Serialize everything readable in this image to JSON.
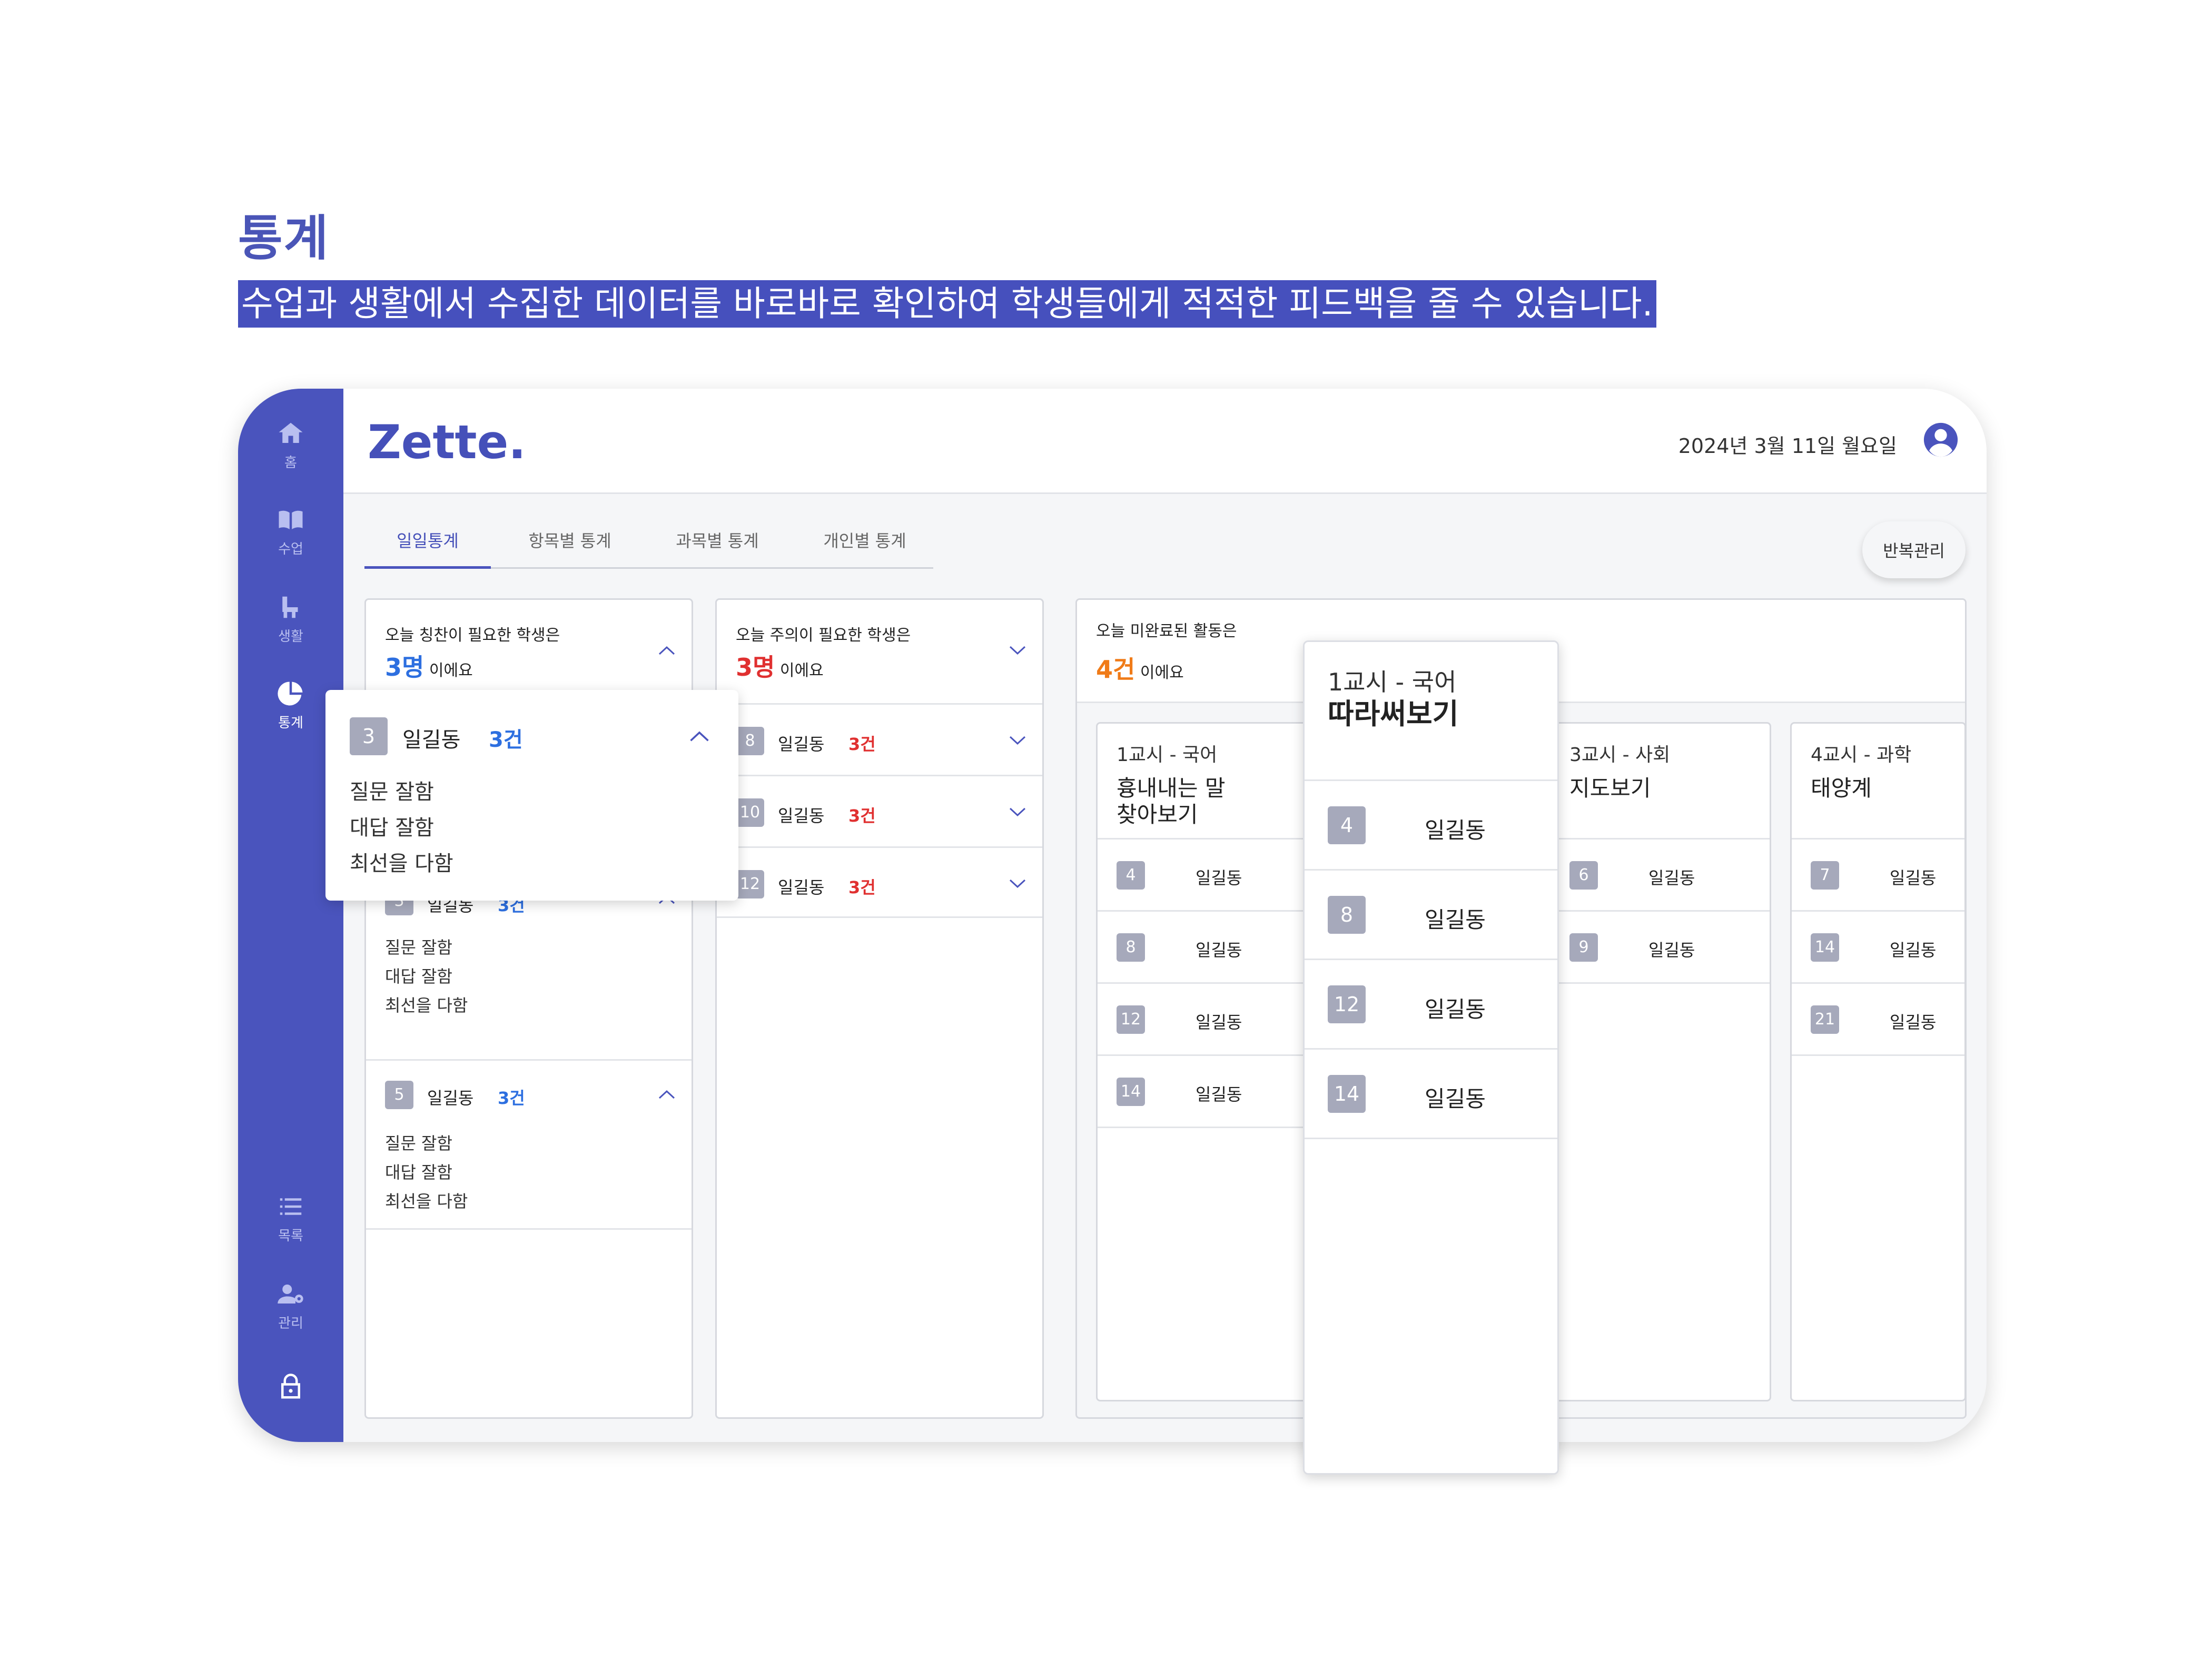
{
  "header": {
    "title": "통계",
    "subtitle": "수업과 생활에서 수집한 데이터를 바로바로 확인하여 학생들에게 적적한 피드백을 줄 수 있습니다."
  },
  "app": {
    "logo": "Zette.",
    "date": "2024년 3월 11일 월요일",
    "accent": "#4a54bd"
  },
  "sidebar": {
    "items": [
      {
        "label": "홈",
        "icon": "home-icon"
      },
      {
        "label": "수업",
        "icon": "book-icon"
      },
      {
        "label": "생활",
        "icon": "chair-icon"
      },
      {
        "label": "통계",
        "icon": "pie-chart-icon"
      },
      {
        "label": "목록",
        "icon": "list-icon"
      },
      {
        "label": "관리",
        "icon": "user-gear-icon"
      }
    ],
    "lock_icon": "lock-icon"
  },
  "tabs": [
    "일일통계",
    "항목별 통계",
    "과목별 통계",
    "개인별 통계"
  ],
  "repeat_button": "반복관리",
  "praise": {
    "title": "오늘 칭찬이 필요한 학생은",
    "count": "3명",
    "suffix": "이에요",
    "rows": [
      {
        "num": "3",
        "name": "일길동",
        "count": "3건",
        "details": [
          "질문 잘함",
          "대답 잘함",
          "최선을 다함"
        ]
      },
      {
        "num": "5",
        "name": "일길동",
        "count": "3건",
        "details": [
          "질문 잘함",
          "대답 잘함",
          "최선을 다함"
        ]
      }
    ]
  },
  "caution": {
    "title": "오늘 주의이 필요한 학생은",
    "count": "3명",
    "suffix": "이에요",
    "rows": [
      {
        "num": "8",
        "name": "일길동",
        "count": "3건"
      },
      {
        "num": "10",
        "name": "일길동",
        "count": "3건"
      },
      {
        "num": "12",
        "name": "일길동",
        "count": "3건"
      }
    ]
  },
  "activities": {
    "title": "오늘 미완료된 활동은",
    "count": "4건",
    "suffix": "이에요",
    "columns": [
      {
        "period": "1교시 - 국어",
        "name": "흉내내는 말 찾아보기",
        "name_lines": [
          "흉내내는 말",
          "찾아보기"
        ],
        "rows": [
          {
            "num": "4",
            "name": "일길동"
          },
          {
            "num": "8",
            "name": "일길동"
          },
          {
            "num": "12",
            "name": "일길동"
          },
          {
            "num": "14",
            "name": "일길동"
          }
        ]
      },
      {
        "period": "3교시 - 사회",
        "name": "지도보기",
        "rows": [
          {
            "num": "6",
            "name": "일길동"
          },
          {
            "num": "9",
            "name": "일길동"
          }
        ]
      },
      {
        "period": "4교시 - 과학",
        "name": "태양계",
        "rows": [
          {
            "num": "7",
            "name": "일길동"
          },
          {
            "num": "14",
            "name": "일길동"
          },
          {
            "num": "21",
            "name": "일길동"
          }
        ]
      }
    ]
  },
  "popup_praise": {
    "num": "3",
    "name": "일길동",
    "count": "3건",
    "details": [
      "질문 잘함",
      "대답 잘함",
      "최선을 다함"
    ]
  },
  "popup_activity": {
    "period": "1교시 - 국어",
    "name": "따라써보기",
    "rows": [
      {
        "num": "4",
        "name": "일길동"
      },
      {
        "num": "8",
        "name": "일길동"
      },
      {
        "num": "12",
        "name": "일길동"
      },
      {
        "num": "14",
        "name": "일길동"
      }
    ]
  }
}
